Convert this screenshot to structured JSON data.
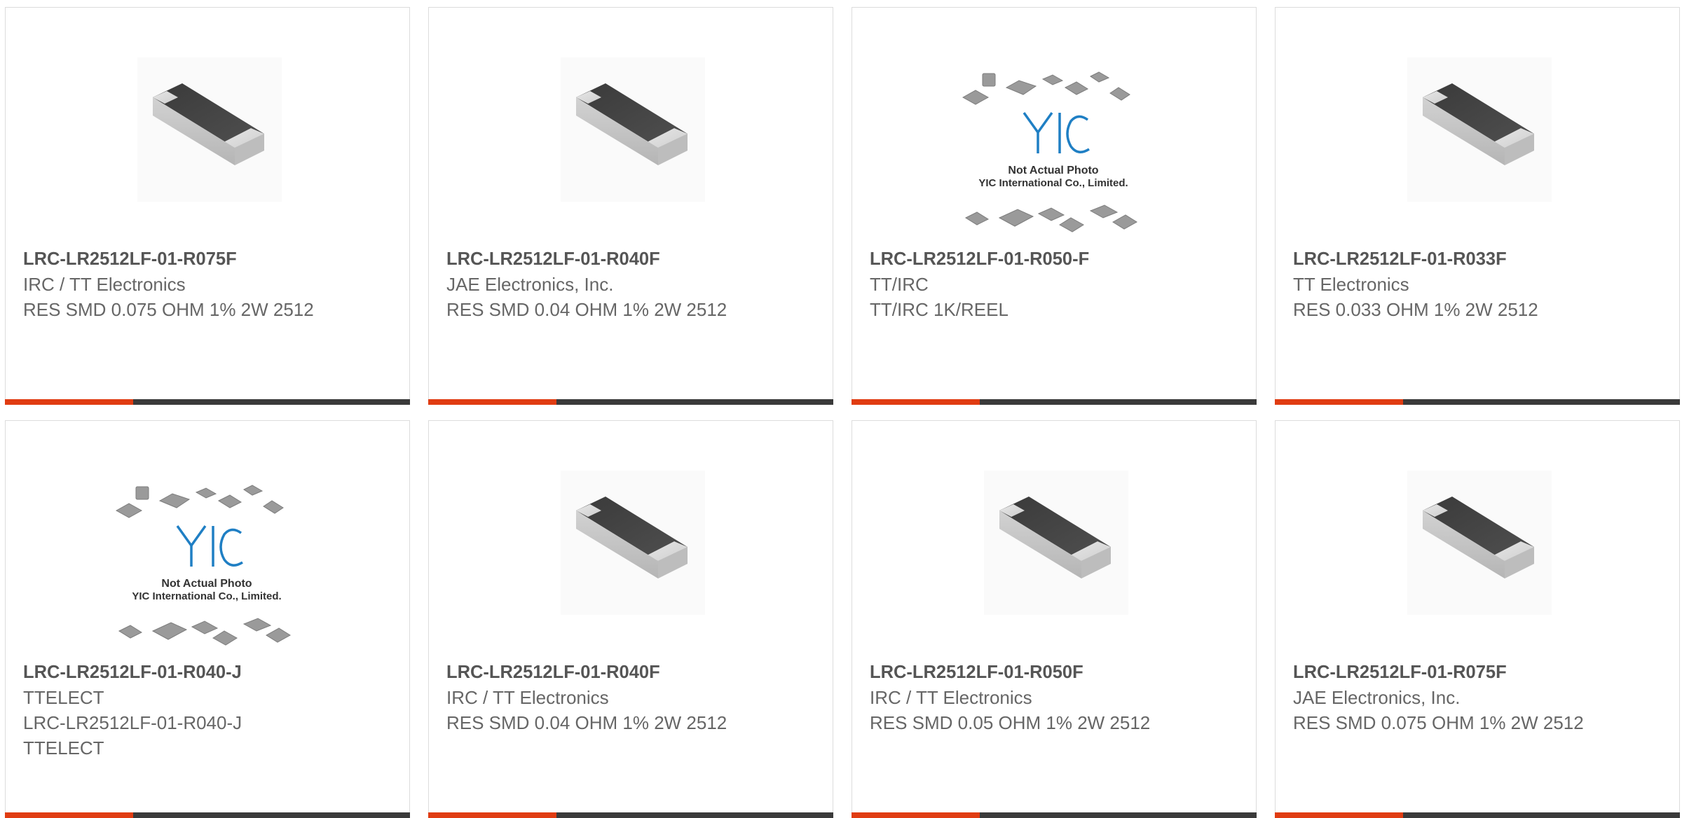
{
  "products": [
    {
      "part_number": "LRC-LR2512LF-01-R075F",
      "manufacturer": "IRC / TT Electronics",
      "description": "RES SMD 0.075 OHM 1% 2W 2512",
      "image": "chip-resistor-photo"
    },
    {
      "part_number": "LRC-LR2512LF-01-R040F",
      "manufacturer": "JAE Electronics, Inc.",
      "description": "RES SMD 0.04 OHM 1% 2W 2512",
      "image": "chip-resistor-photo"
    },
    {
      "part_number": "LRC-LR2512LF-01-R050-F",
      "manufacturer": "TT/IRC",
      "description": "TT/IRC 1K/REEL",
      "image": "placeholder-not-actual-photo"
    },
    {
      "part_number": "LRC-LR2512LF-01-R033F",
      "manufacturer": "TT Electronics",
      "description": "RES 0.033 OHM 1% 2W 2512",
      "image": "chip-resistor-photo"
    },
    {
      "part_number": "LRC-LR2512LF-01-R040-J",
      "manufacturer": "TTELECT",
      "description": "LRC-LR2512LF-01-R040-J TTELECT",
      "image": "placeholder-not-actual-photo"
    },
    {
      "part_number": "LRC-LR2512LF-01-R040F",
      "manufacturer": "IRC / TT Electronics",
      "description": "RES SMD 0.04 OHM 1% 2W 2512",
      "image": "chip-resistor-photo"
    },
    {
      "part_number": "LRC-LR2512LF-01-R050F",
      "manufacturer": "IRC / TT Electronics",
      "description": "RES SMD 0.05 OHM 1% 2W 2512",
      "image": "chip-resistor-photo"
    },
    {
      "part_number": "LRC-LR2512LF-01-R075F",
      "manufacturer": "JAE Electronics, Inc.",
      "description": "RES SMD 0.075 OHM 1% 2W 2512",
      "image": "chip-resistor-photo"
    }
  ],
  "placeholder": {
    "logo_text": "YIC",
    "line1": "Not Actual Photo",
    "line2": "YIC International Co., Limited."
  },
  "colors": {
    "accent": "#e03c12",
    "bar": "#3a3a3a",
    "logo": "#1f7fc4",
    "title": "#555555",
    "text": "#666666"
  }
}
